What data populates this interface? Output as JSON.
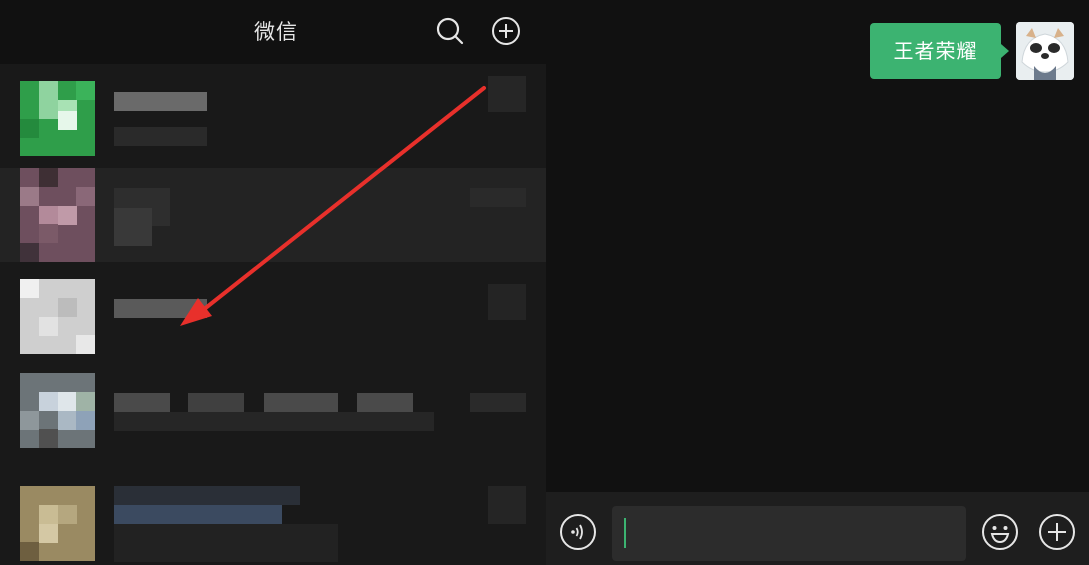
{
  "header": {
    "title": "微信",
    "search_icon": "search-icon",
    "add_icon": "plus-circle-icon"
  },
  "chat": {
    "message_text": "王者荣耀",
    "input_value": "",
    "voice_icon": "voice-icon",
    "emoji_icon": "emoji-icon",
    "more_icon": "plus-circle-icon"
  },
  "colors": {
    "accent": "#3cb371",
    "background": "#111111",
    "list_background": "#191919",
    "annotation_arrow": "#e8302b"
  }
}
